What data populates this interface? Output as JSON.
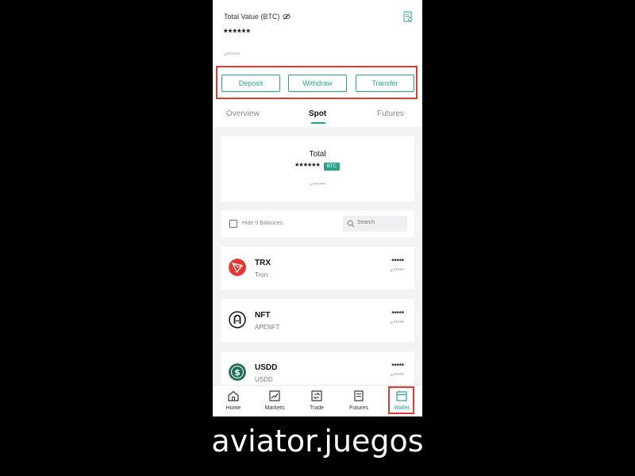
{
  "header": {
    "total_value_label": "Total Value (BTC)",
    "total_value": "******",
    "total_value_sub": "≈******"
  },
  "actions": {
    "deposit": "Deposit",
    "withdraw": "Withdraw",
    "transfer": "Transfer"
  },
  "tabs": [
    {
      "label": "Overview",
      "active": false
    },
    {
      "label": "Spot",
      "active": true
    },
    {
      "label": "Futures",
      "active": false
    }
  ],
  "spot_total": {
    "label": "Total",
    "value": "******",
    "currency": "BTC",
    "sub": "≈******"
  },
  "filter": {
    "hide_zero_label": "Hide 0 Balances",
    "search_placeholder": "Search"
  },
  "assets": [
    {
      "symbol": "TRX",
      "name": "Tron",
      "amount": "*****",
      "value": "≈*****",
      "icon": "tron-icon",
      "color": "#e5382f"
    },
    {
      "symbol": "NFT",
      "name": "APENFT",
      "amount": "*****",
      "value": "≈*****",
      "icon": "apenft-icon",
      "color": "#111111"
    },
    {
      "symbol": "USDD",
      "name": "USDD",
      "amount": "*****",
      "value": "≈*****",
      "icon": "usdd-icon",
      "color": "#1f6f5a"
    }
  ],
  "nav": [
    {
      "label": "Home",
      "icon": "home-icon"
    },
    {
      "label": "Markets",
      "icon": "markets-icon"
    },
    {
      "label": "Trade",
      "icon": "trade-icon"
    },
    {
      "label": "Futures",
      "icon": "futures-icon"
    },
    {
      "label": "Wallet",
      "icon": "wallet-icon",
      "active": true
    }
  ],
  "watermark": "aviator.juegos",
  "colors": {
    "accent": "#27a58c",
    "highlight": "#e5382f"
  }
}
